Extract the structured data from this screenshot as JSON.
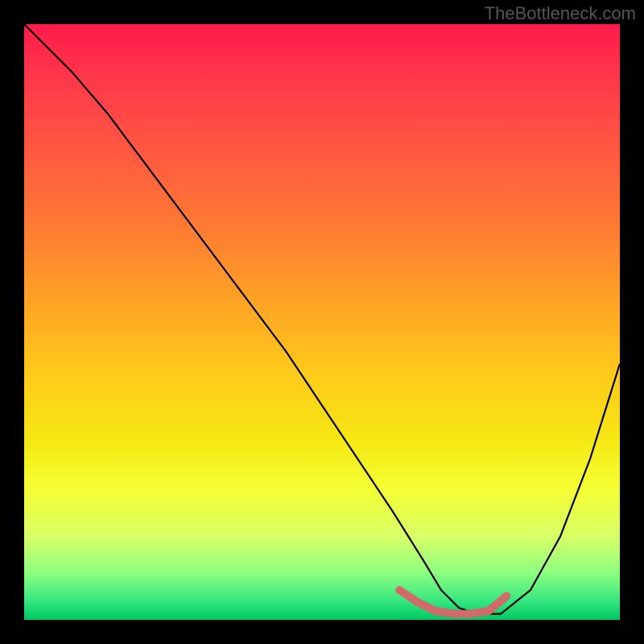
{
  "watermark": "TheBottleneck.com",
  "chart_data": {
    "type": "line",
    "title": "",
    "xlabel": "",
    "ylabel": "",
    "xlim": [
      0,
      100
    ],
    "ylim": [
      0,
      100
    ],
    "series": [
      {
        "name": "bottleneck-curve",
        "x": [
          0,
          3,
          8,
          14,
          20,
          26,
          32,
          38,
          44,
          50,
          56,
          62,
          67,
          70,
          73,
          76,
          80,
          85,
          90,
          95,
          100
        ],
        "values": [
          100,
          97,
          92,
          85,
          77,
          69,
          61,
          53,
          45,
          36,
          27,
          18,
          10,
          5,
          2,
          1,
          1,
          5,
          14,
          27,
          43
        ]
      }
    ],
    "highlight_region": {
      "name": "optimal-range",
      "x": [
        63,
        66,
        69,
        72,
        75,
        78,
        81
      ],
      "values": [
        5,
        3,
        1.5,
        1,
        1,
        1.5,
        4
      ],
      "color": "#d16a6a"
    },
    "background": "rainbow-vertical-gradient"
  }
}
